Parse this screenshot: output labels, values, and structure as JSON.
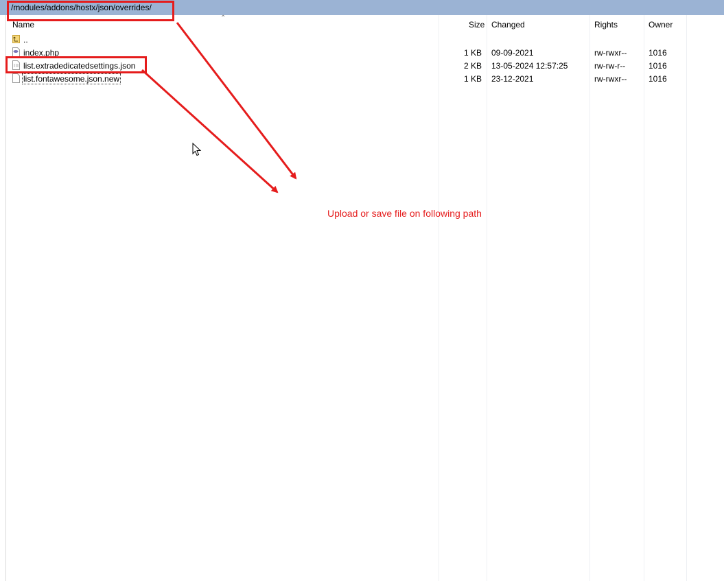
{
  "path": "/modules/addons/hostx/json/overrides/",
  "columns": {
    "name": "Name",
    "size": "Size",
    "changed": "Changed",
    "rights": "Rights",
    "owner": "Owner"
  },
  "files": [
    {
      "name": "..",
      "size": "",
      "changed": "",
      "rights": "",
      "owner": "",
      "icon": "parent-folder-icon"
    },
    {
      "name": "index.php",
      "size": "1 KB",
      "changed": "09-09-2021",
      "rights": "rw-rwxr--",
      "owner": "1016",
      "icon": "php-file-icon"
    },
    {
      "name": "list.extradedicatedsettings.json",
      "size": "2 KB",
      "changed": "13-05-2024 12:57:25",
      "rights": "rw-rw-r--",
      "owner": "1016",
      "icon": "json-file-icon"
    },
    {
      "name": "list.fontawesome.json.new",
      "size": "1 KB",
      "changed": "23-12-2021",
      "rights": "rw-rwxr--",
      "owner": "1016",
      "icon": "blank-file-icon"
    }
  ],
  "annotation": {
    "text": "Upload or save file on following path",
    "color": "#e51c1c"
  },
  "colors": {
    "path_bar": "#9bb3d4",
    "annotation": "#e51c1c"
  }
}
